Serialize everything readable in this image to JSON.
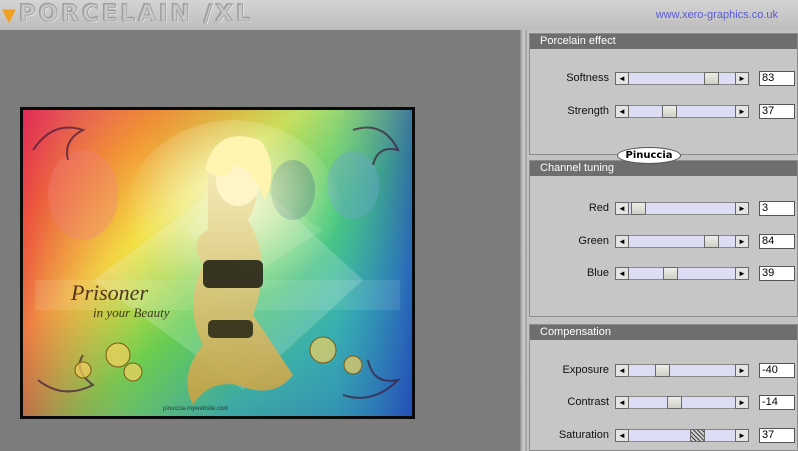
{
  "app": {
    "logo_text": "PORCELAIN /XL",
    "website": "www.xero-graphics.co.uk"
  },
  "preview": {
    "artwork_title": "Prisoner",
    "artwork_subtitle": "in your Beauty",
    "artwork_credit": "pinuccia-mywebsite.com"
  },
  "watermark": "Pinuccia",
  "groups": [
    {
      "title": "Porcelain effect",
      "controls": [
        {
          "label": "Softness",
          "value": 83,
          "min": 0,
          "max": 100
        },
        {
          "label": "Strength",
          "value": 37,
          "min": 0,
          "max": 100
        }
      ]
    },
    {
      "title": "Channel tuning",
      "controls": [
        {
          "label": "Red",
          "value": 3,
          "min": 0,
          "max": 100
        },
        {
          "label": "Green",
          "value": 84,
          "min": 0,
          "max": 100
        },
        {
          "label": "Blue",
          "value": 39,
          "min": 0,
          "max": 100
        }
      ]
    },
    {
      "title": "Compensation",
      "controls": [
        {
          "label": "Exposure",
          "value": -40,
          "min": -100,
          "max": 100
        },
        {
          "label": "Contrast",
          "value": -14,
          "min": -100,
          "max": 100
        },
        {
          "label": "Saturation",
          "value": 37,
          "min": -100,
          "max": 100,
          "focused": true
        }
      ]
    }
  ],
  "icons": {
    "left_arrow": "left-arrow-icon",
    "right_arrow": "right-arrow-icon"
  }
}
